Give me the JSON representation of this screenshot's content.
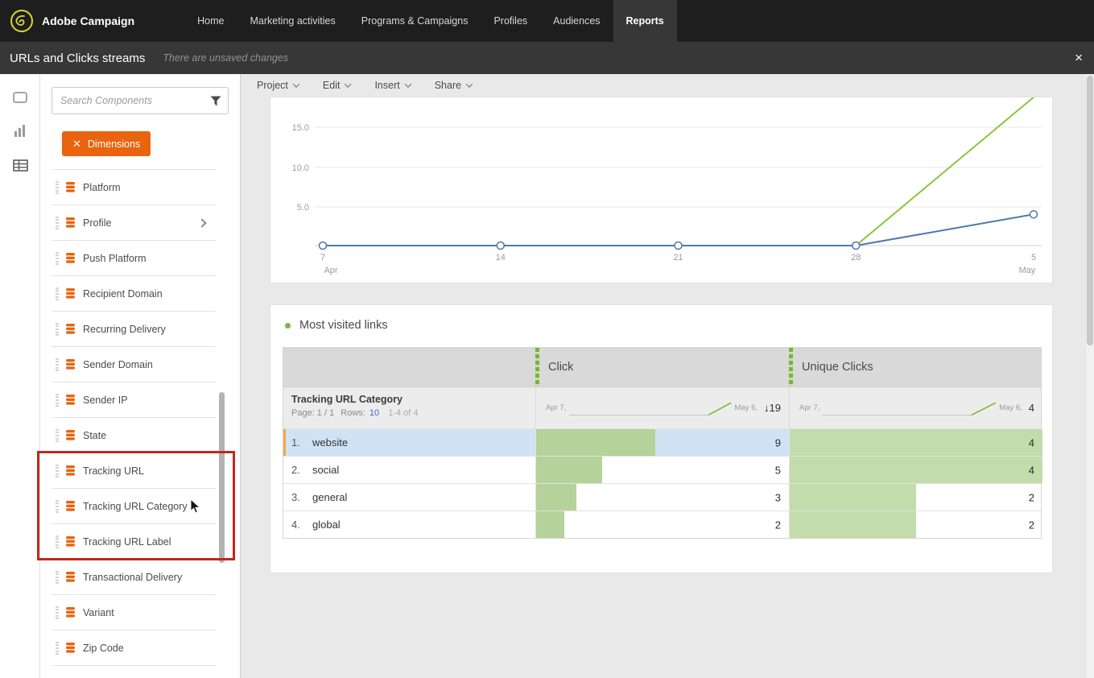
{
  "topbar": {
    "brand": "Adobe Campaign",
    "nav": [
      {
        "label": "Home",
        "active": false
      },
      {
        "label": "Marketing activities",
        "active": false
      },
      {
        "label": "Programs & Campaigns",
        "active": false
      },
      {
        "label": "Profiles",
        "active": false
      },
      {
        "label": "Audiences",
        "active": false
      },
      {
        "label": "Reports",
        "active": true
      }
    ]
  },
  "subheader": {
    "title": "URLs and Clicks streams",
    "status_message": "There are unsaved changes",
    "close_label": "×"
  },
  "toolstrip": {
    "icons": [
      "layout-icon",
      "bar-chart-icon",
      "table-icon"
    ]
  },
  "components_panel": {
    "search_placeholder": "Search Components",
    "dimensions_chip": {
      "remove_label": "✕",
      "label": "Dimensions"
    },
    "items": [
      {
        "label": "Platform"
      },
      {
        "label": "Profile",
        "has_children": true
      },
      {
        "label": "Push Platform"
      },
      {
        "label": "Recipient Domain"
      },
      {
        "label": "Recurring Delivery"
      },
      {
        "label": "Sender Domain"
      },
      {
        "label": "Sender IP"
      },
      {
        "label": "State"
      },
      {
        "label": "Tracking URL",
        "highlighted": true
      },
      {
        "label": "Tracking URL Category",
        "highlighted": true
      },
      {
        "label": "Tracking URL Label",
        "highlighted": true
      },
      {
        "label": "Transactional Delivery"
      },
      {
        "label": "Variant"
      },
      {
        "label": "Zip Code"
      }
    ]
  },
  "menubar": {
    "items": [
      {
        "label": "Project"
      },
      {
        "label": "Edit"
      },
      {
        "label": "Insert"
      },
      {
        "label": "Share"
      }
    ]
  },
  "chart_data": {
    "type": "line",
    "x_labels": [
      "7",
      "14",
      "21",
      "28",
      "5"
    ],
    "x_month_labels": [
      "Apr",
      "May"
    ],
    "y_tick_labels": [
      "15.0",
      "10.0",
      "5.0"
    ],
    "yticks": [
      15.0,
      10.0,
      5.0
    ],
    "ylim": [
      0,
      19
    ],
    "grid": true,
    "legend": "none",
    "series": [
      {
        "name": "Click",
        "color": "#8bc63f",
        "values": [
          0,
          0,
          0,
          0,
          19
        ]
      },
      {
        "name": "Unique Clicks",
        "color": "#4d79a9",
        "values": [
          0,
          0,
          0,
          0,
          4
        ],
        "markers": true
      }
    ]
  },
  "most_visited": {
    "title": "Most visited links",
    "column_headers": [
      {
        "label": "Click"
      },
      {
        "label": "Unique Clicks"
      }
    ],
    "dimension_header": {
      "title": "Tracking URL Category",
      "page_text": "Page: 1 / 1",
      "rows_label": "Rows:",
      "rows_value": "10",
      "range_text": "1-4 of 4"
    },
    "spark": {
      "start_label": "Apr 7,",
      "end_label": "May 6,"
    },
    "totals": {
      "click_sort_icon": "↓",
      "click_total": "19",
      "unique_total": "4"
    },
    "rows": [
      {
        "rank": "1.",
        "label": "website",
        "click": "9",
        "unique": "4",
        "click_frac": 0.47,
        "unique_frac": 1,
        "selected": true
      },
      {
        "rank": "2.",
        "label": "social",
        "click": "5",
        "unique": "4",
        "click_frac": 0.26,
        "unique_frac": 1,
        "selected": false
      },
      {
        "rank": "3.",
        "label": "general",
        "click": "3",
        "unique": "2",
        "click_frac": 0.16,
        "unique_frac": 0.5,
        "selected": false
      },
      {
        "rank": "4.",
        "label": "global",
        "click": "2",
        "unique": "2",
        "click_frac": 0.11,
        "unique_frac": 0.5,
        "selected": false
      }
    ]
  },
  "colors": {
    "accent_orange": "#e8640f",
    "chart_green": "#8bc63f",
    "chart_blue": "#4d79a9",
    "bar_green": "#b4d29a",
    "selection_blue": "#cfe3f5",
    "selection_accent": "#f0a945",
    "annotation_red": "#c0281e",
    "header_green": "#76b72f"
  }
}
